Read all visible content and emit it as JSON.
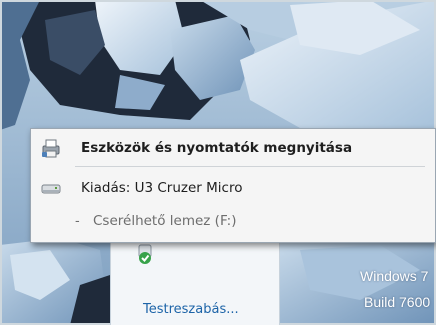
{
  "popup": {
    "devices_printers_label": "Eszközök és nyomtatók megnyitása",
    "eject_label": "Kiadás: U3 Cruzer Micro",
    "removable_disk_label": "Cserélhető lemez (F:)",
    "sub_prefix": "-"
  },
  "tray": {
    "customize_link": "Testreszabás..."
  },
  "watermark": {
    "line1": "Windows 7",
    "line2": "Build 7600"
  },
  "icons": {
    "devices": "printer-icon",
    "eject": "drive-icon",
    "usb": "usb-safely-remove-icon"
  }
}
